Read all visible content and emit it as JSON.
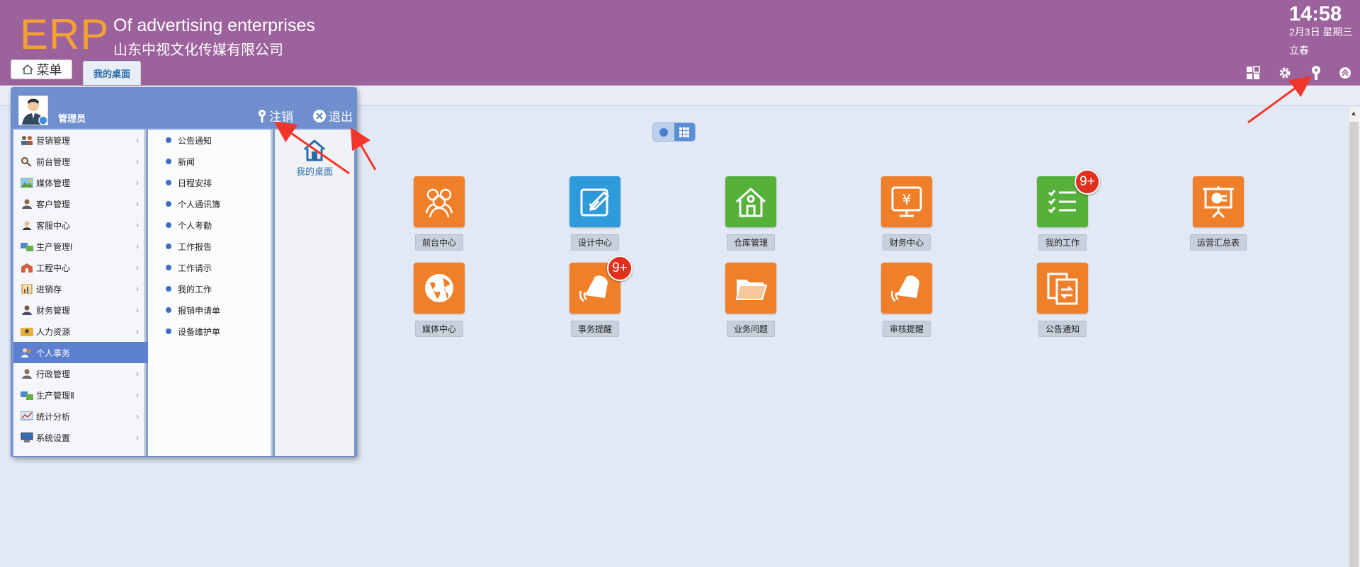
{
  "header": {
    "logo": "ERP",
    "subtitle_en": "Of advertising enterprises",
    "subtitle_cn": "山东中视文化传媒有限公司",
    "time": "14:58",
    "date": "2月3日 星期三",
    "solar_term": "立春",
    "icons": [
      "layout-icon",
      "gear-icon",
      "pin-icon",
      "collapse-icon"
    ]
  },
  "nav": {
    "menu_label": "菜单",
    "tab_label": "我的桌面"
  },
  "menu": {
    "user": "管理员",
    "logout": "注销",
    "exit": "退出",
    "categories": [
      {
        "label": "营销管理",
        "arrow": true
      },
      {
        "label": "前台管理",
        "arrow": true
      },
      {
        "label": "媒体管理",
        "arrow": true
      },
      {
        "label": "客户管理",
        "arrow": true
      },
      {
        "label": "客服中心",
        "arrow": true
      },
      {
        "label": "生产管理Ⅰ",
        "arrow": true
      },
      {
        "label": "工程中心",
        "arrow": true
      },
      {
        "label": "进销存",
        "arrow": true
      },
      {
        "label": "财务管理",
        "arrow": true
      },
      {
        "label": "人力资源",
        "arrow": true
      },
      {
        "label": "个人事务",
        "arrow": false
      },
      {
        "label": "行政管理",
        "arrow": true
      },
      {
        "label": "生产管理Ⅱ",
        "arrow": true
      },
      {
        "label": "统计分析",
        "arrow": true
      },
      {
        "label": "系统设置",
        "arrow": true
      }
    ],
    "active_index": 10,
    "subitems": [
      "公告通知",
      "新闻",
      "日程安排",
      "个人通讯簿",
      "个人考勤",
      "工作报告",
      "工作请示",
      "我的工作",
      "报销申请单",
      "设备维护单"
    ],
    "favorite": "我的桌面"
  },
  "desktop": {
    "apps": [
      {
        "label": "前台中心",
        "icon": "people-icon",
        "color": "#f07f2a"
      },
      {
        "label": "设计中心",
        "icon": "design-edit-icon",
        "color": "#2f9ad9"
      },
      {
        "label": "仓库管理",
        "icon": "warehouse-icon",
        "color": "#56b13a"
      },
      {
        "label": "财务中心",
        "icon": "finance-yen-icon",
        "color": "#f07f2a"
      },
      {
        "label": "我的工作",
        "icon": "checklist-icon",
        "color": "#56b13a",
        "badge": "9+"
      },
      {
        "label": "运营汇总表",
        "icon": "presentation-icon",
        "color": "#f07f2a"
      },
      {
        "label": "媒体中心",
        "icon": "globe-icon",
        "color": "#f07f2a"
      },
      {
        "label": "事务提醒",
        "icon": "bell-icon",
        "color": "#f07f2a",
        "badge": "9+"
      },
      {
        "label": "业务问题",
        "icon": "folder-icon",
        "color": "#f07f2a"
      },
      {
        "label": "审核提醒",
        "icon": "bell-icon",
        "color": "#f07f2a"
      },
      {
        "label": "公告通知",
        "icon": "notice-icon",
        "color": "#f07f2a"
      }
    ]
  },
  "colors": {
    "topbar": "#9c629c",
    "logo": "#f5a033",
    "menu_panel": "#7f9cd3",
    "active_item": "#5d7fcf",
    "badge": "#e0301e",
    "annotation_arrow": "#f2352b"
  }
}
